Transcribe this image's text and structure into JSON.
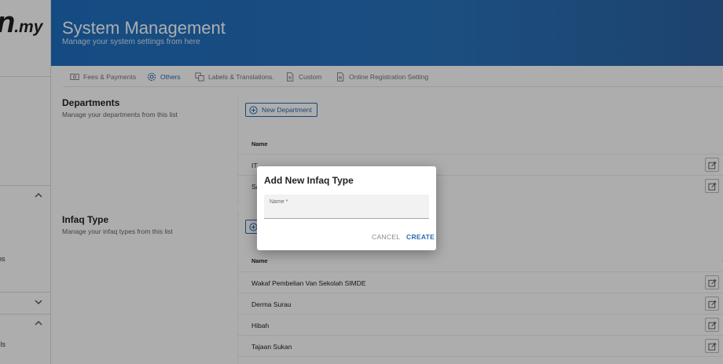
{
  "sidebar": {
    "logo_big": "n",
    "logo_small": ".my",
    "text_1": "ns",
    "text_2": "tails"
  },
  "header": {
    "title": "System Management",
    "subtitle": "Manage your system settings from here"
  },
  "tabs": [
    {
      "label": "Fees & Payments",
      "icon": "money-icon",
      "active": false
    },
    {
      "label": "Others",
      "icon": "gear-icon",
      "active": true
    },
    {
      "label": "Labels & Translations.",
      "icon": "translate-icon",
      "active": false
    },
    {
      "label": "Custom",
      "icon": "document-icon",
      "active": false
    },
    {
      "label": "Online Registration Setting",
      "icon": "document-icon",
      "active": false
    }
  ],
  "departments": {
    "title": "Departments",
    "subtitle": "Manage your departments from this list",
    "new_button": "New Department",
    "column": "Name",
    "rows": [
      "IT",
      "Sa"
    ]
  },
  "infaq": {
    "title": "Infaq Type",
    "subtitle": "Manage your infaq types from this list",
    "column": "Name",
    "rows": [
      "Wakaf Pembelian Van Sekolah SIMDE",
      "Derma Surau",
      "Hibah",
      "Tajaan Sukan"
    ]
  },
  "dialog": {
    "title": "Add New Infaq Type",
    "field_label": "Name *",
    "field_value": "",
    "cancel": "CANCEL",
    "create": "CREATE"
  },
  "colors": {
    "accent": "#2a6ab3",
    "header": "#1f6fc1"
  }
}
